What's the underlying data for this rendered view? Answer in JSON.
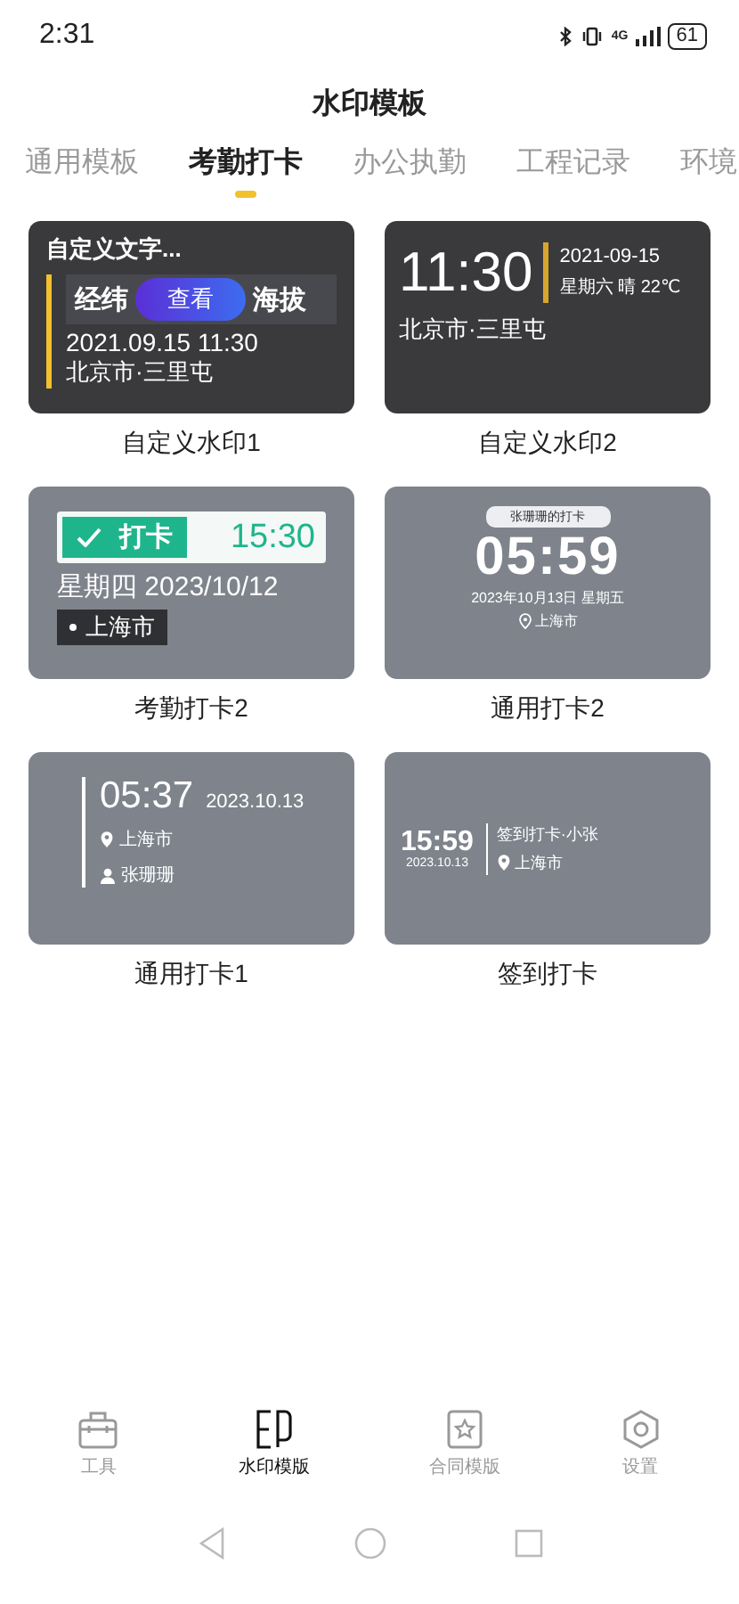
{
  "status_bar": {
    "time": "2:31",
    "network": "4G",
    "battery": "61"
  },
  "header": {
    "title": "水印模板"
  },
  "tabs": [
    {
      "label": "通用模板",
      "selected": false
    },
    {
      "label": "考勤打卡",
      "selected": true
    },
    {
      "label": "办公执勤",
      "selected": false
    },
    {
      "label": "工程记录",
      "selected": false
    },
    {
      "label": "环境",
      "selected": false
    }
  ],
  "templates": [
    {
      "kind": "custom_text",
      "label": "自定义水印1",
      "title": "自定义文字...",
      "fields": [
        "经纬",
        "海拔"
      ],
      "datetime": "2021.09.15  11:30",
      "place": "北京市·三里屯",
      "button": "查看"
    },
    {
      "kind": "big_clock",
      "label": "自定义水印2",
      "time": "11:30",
      "date": "2021-09-15",
      "weather": "星期六 晴 22℃",
      "place": "北京市·三里屯"
    },
    {
      "kind": "punch_badge",
      "label": "考勤打卡2",
      "badge": "打卡",
      "time": "15:30",
      "date": "星期四  2023/10/12",
      "place": "上海市"
    },
    {
      "kind": "center_clock",
      "label": "通用打卡2",
      "tag": "张珊珊的打卡",
      "time": "05:59",
      "date": "2023年10月13日 星期五",
      "place": "上海市"
    },
    {
      "kind": "side_line",
      "label": "通用打卡1",
      "time": "05:37",
      "date": "2023.10.13",
      "place": "上海市",
      "person": "张珊珊"
    },
    {
      "kind": "sign_in",
      "label": "签到打卡",
      "time": "15:59",
      "date": "2023.10.13",
      "title": "签到打卡·小张",
      "place": "上海市"
    }
  ],
  "bottom_nav": [
    {
      "label": "工具",
      "selected": false
    },
    {
      "label": "水印模版",
      "selected": true
    },
    {
      "label": "合同模版",
      "selected": false
    },
    {
      "label": "设置",
      "selected": false
    }
  ]
}
